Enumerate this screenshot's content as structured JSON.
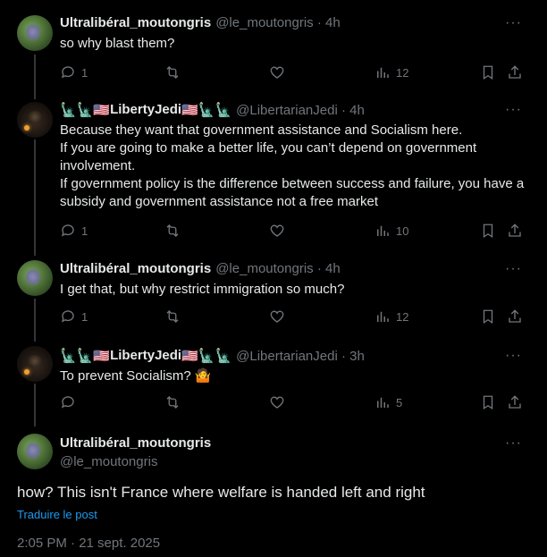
{
  "colors": {
    "accent": "#1d9bf0",
    "muted": "#71767b",
    "text": "#e7e9ea",
    "background": "#000000"
  },
  "thread": [
    {
      "author": "Ultralibéral_moutongris",
      "handle": "@le_moutongris · 4h",
      "avatar": "green-field-avatar",
      "text": "so why blast them?",
      "replies": "1",
      "views": "12"
    },
    {
      "author": "LibertyJedi",
      "handle": "@LibertarianJedi · 4h",
      "avatar": "dark-hooded-avatar",
      "name_emoji_left": [
        "🗽",
        "🗽",
        "🇺🇸"
      ],
      "name_emoji_right": [
        "🇺🇸",
        "🗽",
        "🗽"
      ],
      "text": "Because they want that government assistance and Socialism here.\nIf you are going to make a better life, you can’t depend on government involvement.\nIf government policy is the difference between success and failure, you have a subsidy and government assistance not a free market",
      "replies": "1",
      "views": "10"
    },
    {
      "author": "Ultralibéral_moutongris",
      "handle": "@le_moutongris · 4h",
      "avatar": "green-field-avatar",
      "text": "I get that, but why restrict immigration so much?",
      "replies": "1",
      "views": "12"
    },
    {
      "author": "LibertyJedi",
      "handle": "@LibertarianJedi · 3h",
      "avatar": "dark-hooded-avatar",
      "name_emoji_left": [
        "🗽",
        "🗽",
        "🇺🇸"
      ],
      "name_emoji_right": [
        "🇺🇸",
        "🗽",
        "🗽"
      ],
      "text": "To prevent Socialism? 🤷",
      "replies": "",
      "views": "5"
    }
  ],
  "focus": {
    "author": "Ultralibéral_moutongris",
    "handle": "@le_moutongris",
    "text": "how? This isn't France where welfare is handed left and right",
    "translate_label": "Traduire le post",
    "timestamp": "2:05 PM · 21 sept. 2025"
  },
  "more_label": "···"
}
